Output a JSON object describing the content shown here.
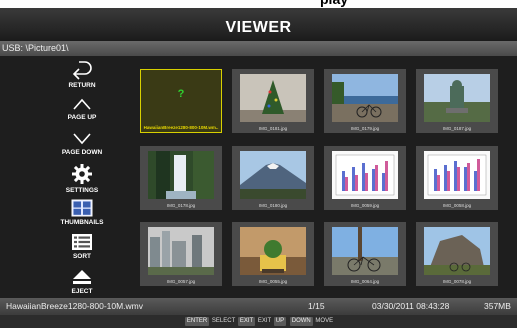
{
  "top_banner_text": "play",
  "header": {
    "title": "VIEWER"
  },
  "path": "USB: \\Picture01\\",
  "sidebar": {
    "items": [
      {
        "label": "RETURN",
        "icon": "return-icon"
      },
      {
        "label": "PAGE UP",
        "icon": "chevron-up-icon"
      },
      {
        "label": "PAGE DOWN",
        "icon": "chevron-down-icon"
      },
      {
        "label": "SETTINGS",
        "icon": "gear-icon"
      },
      {
        "label": "THUMBNAILS",
        "icon": "thumbnails-icon"
      },
      {
        "label": "SORT",
        "icon": "list-icon"
      },
      {
        "label": "EJECT",
        "icon": "eject-icon"
      }
    ]
  },
  "thumbnails": [
    {
      "caption": "HawaiianBreeze1280-800-10M.wm..",
      "selected": true,
      "placeholder": "?"
    },
    {
      "caption": "IMG_0181.jpg"
    },
    {
      "caption": "IMG_0179.jpg"
    },
    {
      "caption": "IMG_0187.jpg"
    },
    {
      "caption": "IMG_0178.jpg"
    },
    {
      "caption": "IMG_0180.jpg"
    },
    {
      "caption": "IMG_0059.jpg"
    },
    {
      "caption": "IMG_0058.jpg"
    },
    {
      "caption": "IMG_0057.jpg"
    },
    {
      "caption": "IMG_0055.jpg"
    },
    {
      "caption": "IMG_0064.jpg"
    },
    {
      "caption": "IMG_0078.jpg"
    }
  ],
  "status": {
    "filename": "HawaiianBreeze1280-800-10M.wmv",
    "page": "1/15",
    "datetime": "03/30/2011 08:43:28",
    "size": "357MB"
  },
  "hints": [
    {
      "key": "ENTER",
      "action": "SELECT"
    },
    {
      "key": "EXIT",
      "action": "EXIT"
    },
    {
      "key": "UP",
      "action": ""
    },
    {
      "key": "DOWN",
      "action": "MOVE"
    }
  ],
  "colors": {
    "selection": "#d8d000",
    "placeholder": "#2fd22f",
    "background": "#1e1e1e"
  }
}
